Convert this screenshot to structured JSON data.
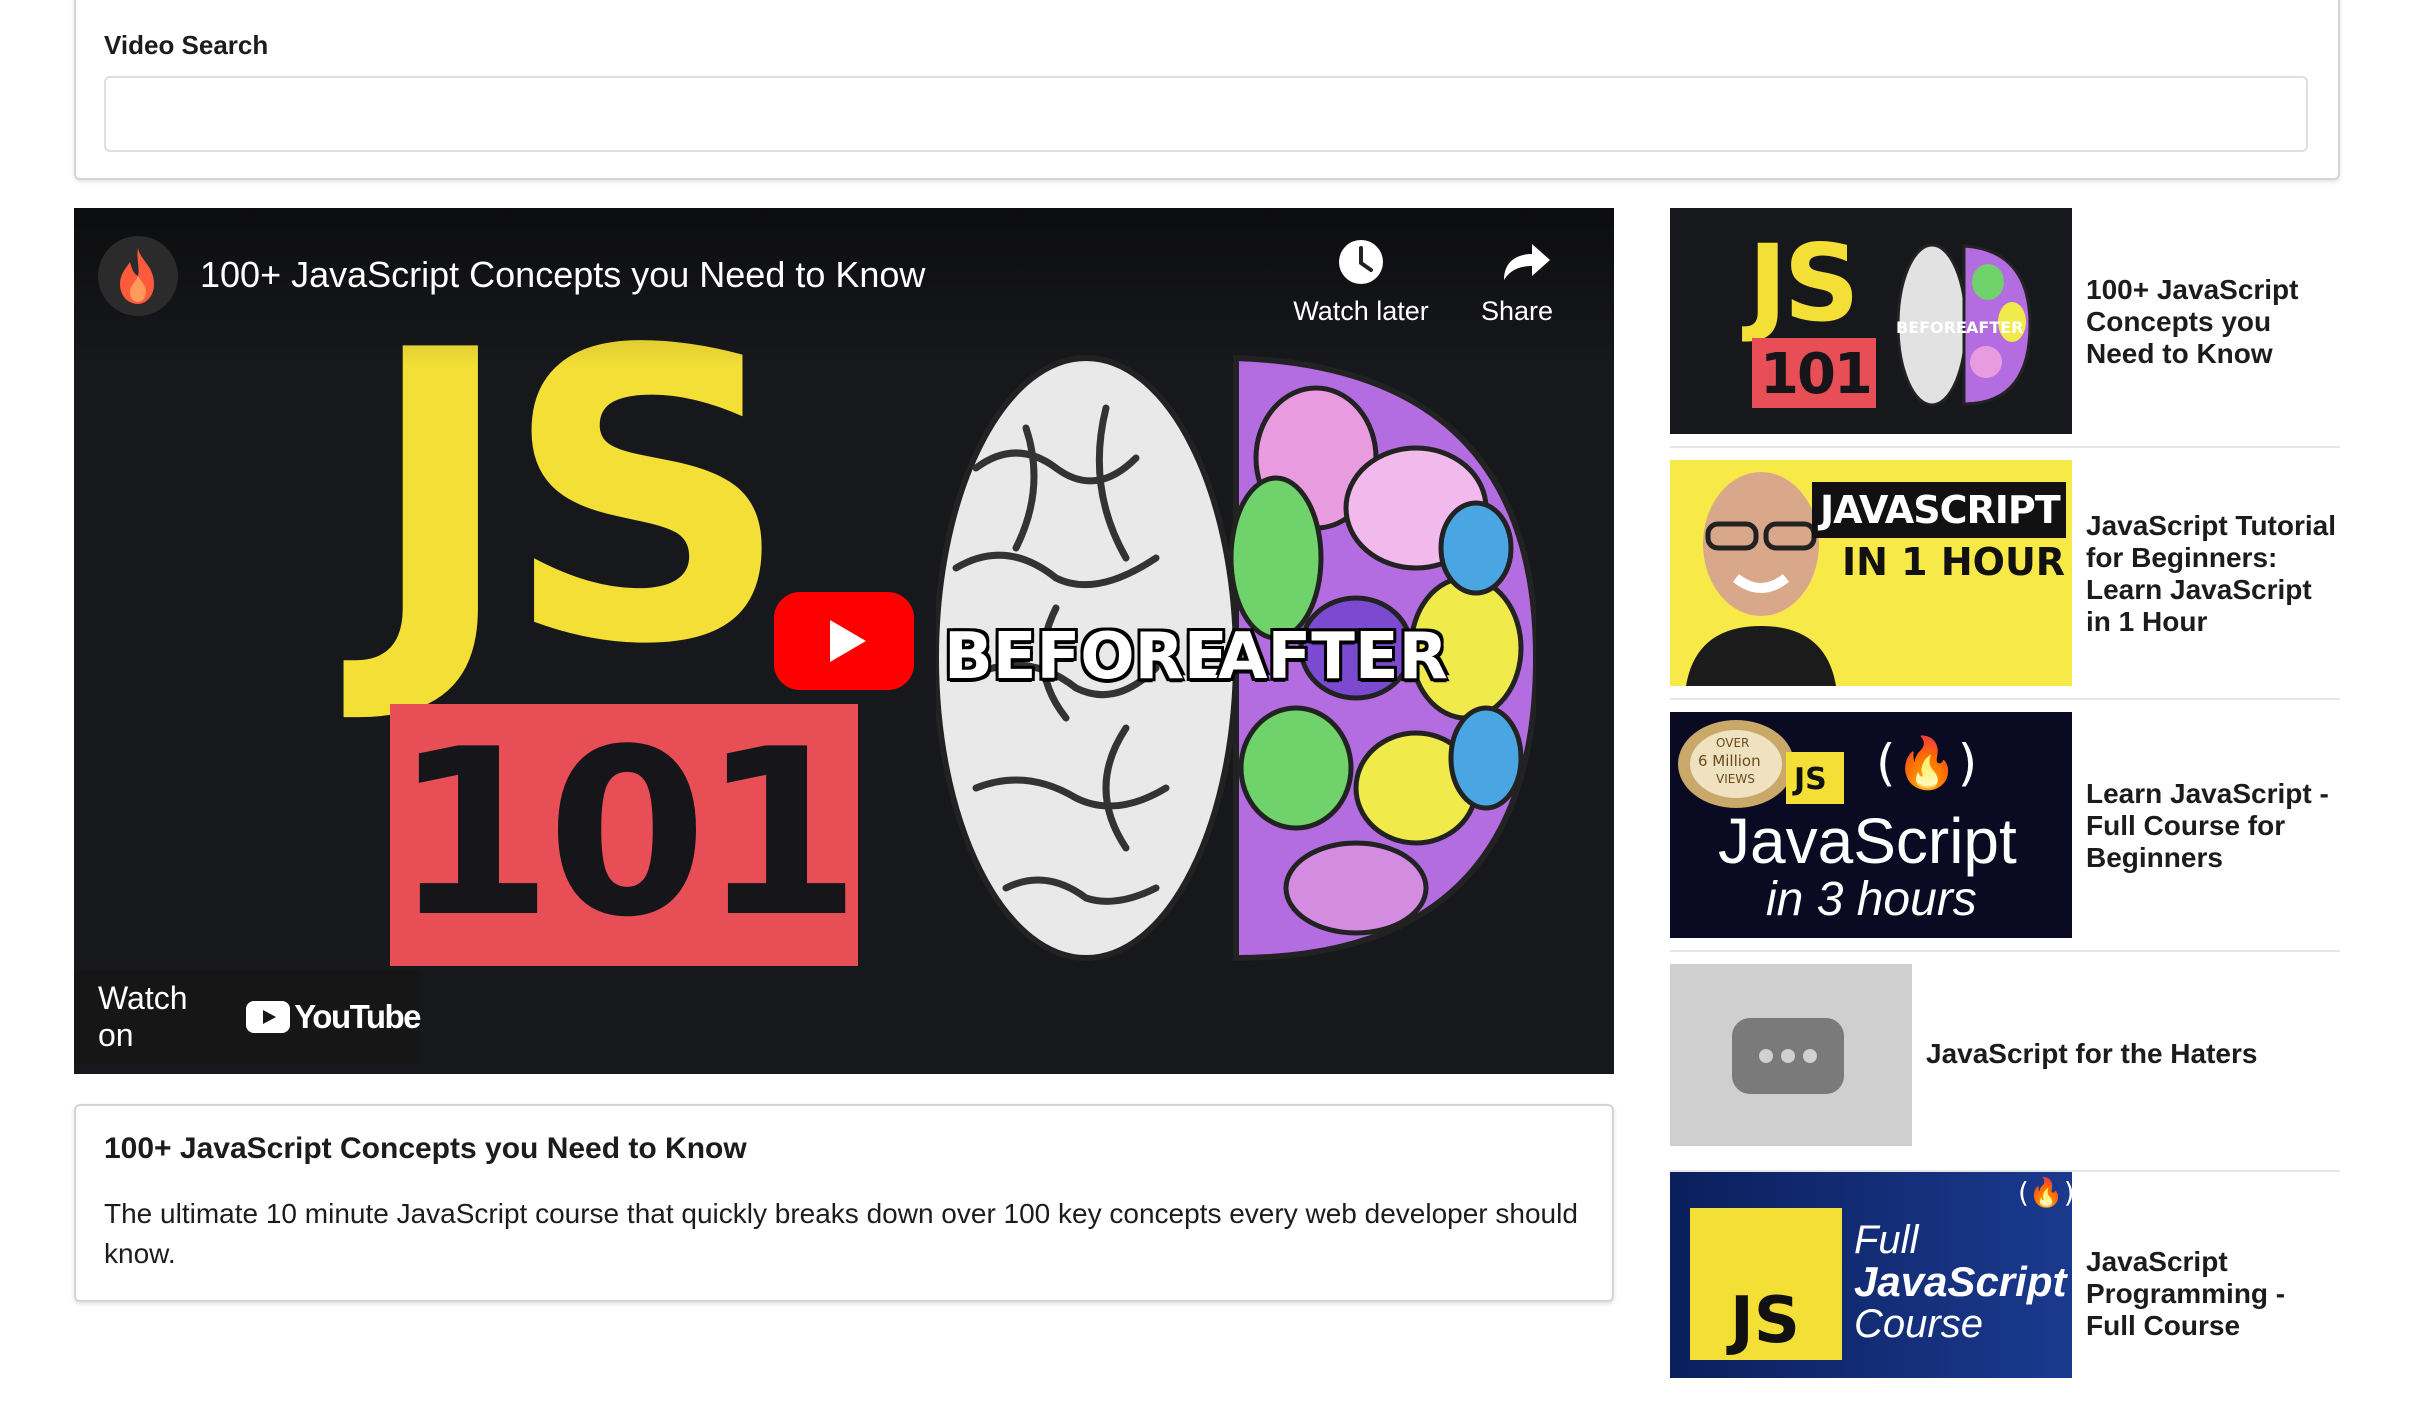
{
  "search": {
    "label": "Video Search",
    "value": ""
  },
  "player": {
    "overlay_title": "100+ JavaScript Concepts you Need to Know",
    "watch_later_label": "Watch later",
    "share_label": "Share",
    "watch_on_label": "Watch on",
    "youtube_word": "YouTube",
    "thumbnail": {
      "js_text": "JS",
      "num_text": "101",
      "before_label": "BEFORE",
      "after_label": "AFTER"
    }
  },
  "details": {
    "title": "100+ JavaScript Concepts you Need to Know",
    "description": "The ultimate 10 minute JavaScript course that quickly breaks down over 100 key concepts every web developer should know."
  },
  "related": [
    {
      "title": "100+ JavaScript Concepts you Need to Know",
      "thumb": {
        "js": "JS",
        "num": "101",
        "before": "BEFORE",
        "after": "AFTER"
      }
    },
    {
      "title": "JavaScript Tutorial for Beginners: Learn JavaScript in 1 Hour",
      "thumb": {
        "line1": "JAVASCRIPT",
        "line2": "IN 1 HOUR"
      }
    },
    {
      "title": "Learn JavaScript - Full Course for Beginners",
      "thumb": {
        "badge_top": "OVER",
        "badge_mid": "6 Million",
        "badge_bottom": "VIEWS",
        "js": "JS",
        "fcc": "(🔥)",
        "line1": "JavaScript",
        "line2": "in 3 hours"
      }
    },
    {
      "title": "JavaScript for the Haters",
      "thumb": {}
    },
    {
      "title": "JavaScript Programming - Full Course",
      "thumb": {
        "fcc": "(🔥)",
        "js": "JS",
        "line1": "Full",
        "line2": "JavaScript",
        "line3": "Course"
      }
    }
  ],
  "colors": {
    "js_yellow": "#f3df36",
    "js101_red": "#e74e55",
    "youtube_red": "#ff0000",
    "fcc_navy": "#0a0a23"
  }
}
